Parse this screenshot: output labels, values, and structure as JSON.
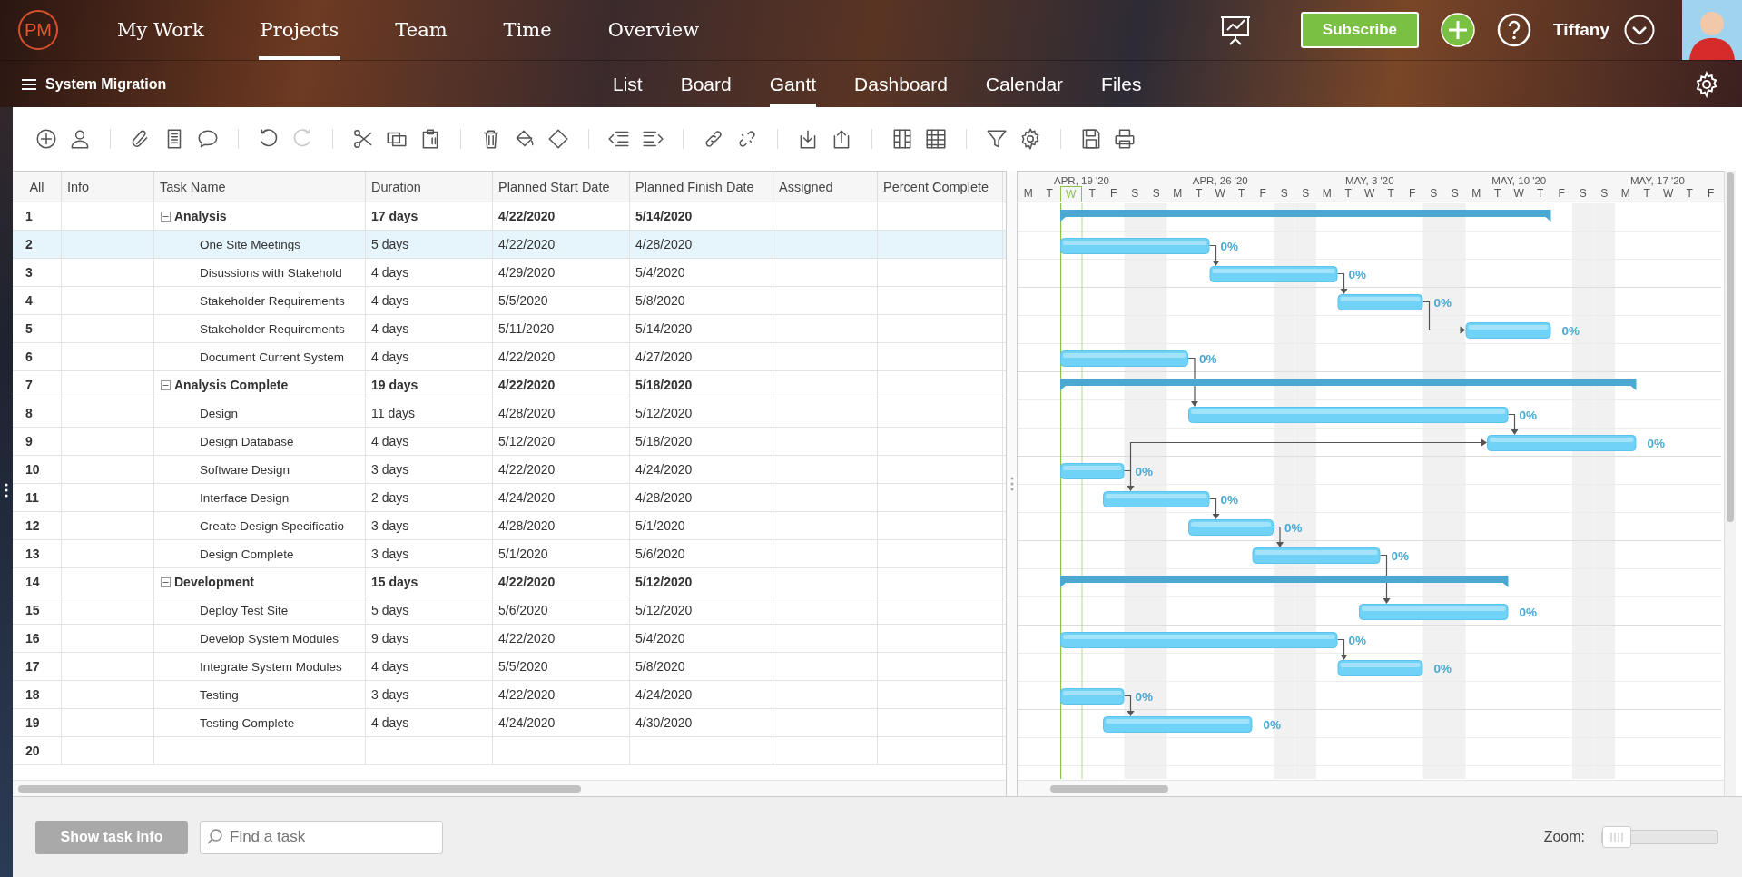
{
  "app": {
    "logo": "PM",
    "nav": [
      {
        "label": "My Work",
        "selected": false
      },
      {
        "label": "Projects",
        "selected": true
      },
      {
        "label": "Team",
        "selected": false
      },
      {
        "label": "Time",
        "selected": false
      },
      {
        "label": "Overview",
        "selected": false
      }
    ],
    "subscribe": "Subscribe",
    "user": "Tiffany"
  },
  "project": {
    "title": "System Migration",
    "views": [
      {
        "label": "List",
        "selected": false
      },
      {
        "label": "Board",
        "selected": false
      },
      {
        "label": "Gantt",
        "selected": true
      },
      {
        "label": "Dashboard",
        "selected": false
      },
      {
        "label": "Calendar",
        "selected": false
      },
      {
        "label": "Files",
        "selected": false
      }
    ]
  },
  "toolbar": {
    "undo_disabled": false,
    "redo_disabled": true
  },
  "grid": {
    "columns": [
      "All",
      "Info",
      "Task Name",
      "Duration",
      "Planned Start Date",
      "Planned Finish Date",
      "Assigned",
      "Percent Complete"
    ],
    "rows": [
      {
        "num": "1",
        "kind": "summary",
        "expanded": true,
        "selected": false,
        "name": "Analysis",
        "duration": "17 days",
        "start": "4/22/2020",
        "finish": "5/14/2020"
      },
      {
        "num": "2",
        "kind": "task",
        "selected": true,
        "name": "One Site Meetings",
        "duration": "5 days",
        "start": "4/22/2020",
        "finish": "4/28/2020",
        "bar_label": "0%"
      },
      {
        "num": "3",
        "kind": "task",
        "selected": false,
        "name": "Disussions with Stakehold",
        "duration": "4 days",
        "start": "4/29/2020",
        "finish": "5/4/2020",
        "bar_label": "0%"
      },
      {
        "num": "4",
        "kind": "task",
        "selected": false,
        "name": "Stakeholder Requirements",
        "duration": "4 days",
        "start": "5/5/2020",
        "finish": "5/8/2020",
        "bar_label": "0%"
      },
      {
        "num": "5",
        "kind": "task",
        "selected": false,
        "name": "Stakeholder Requirements",
        "duration": "4 days",
        "start": "5/11/2020",
        "finish": "5/14/2020",
        "bar_label": "0%"
      },
      {
        "num": "6",
        "kind": "task",
        "selected": false,
        "name": "Document Current System",
        "duration": "4 days",
        "start": "4/22/2020",
        "finish": "4/27/2020",
        "bar_label": "0%"
      },
      {
        "num": "7",
        "kind": "summary",
        "expanded": true,
        "selected": false,
        "name": "Analysis Complete",
        "duration": "19 days",
        "start": "4/22/2020",
        "finish": "5/18/2020"
      },
      {
        "num": "8",
        "kind": "task",
        "selected": false,
        "name": "Design",
        "duration": "11 days",
        "start": "4/28/2020",
        "finish": "5/12/2020",
        "bar_label": "0%"
      },
      {
        "num": "9",
        "kind": "task",
        "selected": false,
        "name": "Design Database",
        "duration": "4 days",
        "start": "5/12/2020",
        "finish": "5/18/2020",
        "bar_label": "0%"
      },
      {
        "num": "10",
        "kind": "task",
        "selected": false,
        "name": "Software Design",
        "duration": "3 days",
        "start": "4/22/2020",
        "finish": "4/24/2020",
        "bar_label": "0%"
      },
      {
        "num": "11",
        "kind": "task",
        "selected": false,
        "name": "Interface Design",
        "duration": "2 days",
        "start": "4/24/2020",
        "finish": "4/28/2020",
        "bar_label": "0%"
      },
      {
        "num": "12",
        "kind": "task",
        "selected": false,
        "name": "Create Design Specificatio",
        "duration": "3 days",
        "start": "4/28/2020",
        "finish": "5/1/2020",
        "bar_label": "0%"
      },
      {
        "num": "13",
        "kind": "task",
        "selected": false,
        "name": "Design Complete",
        "duration": "3 days",
        "start": "5/1/2020",
        "finish": "5/6/2020",
        "bar_label": "0%"
      },
      {
        "num": "14",
        "kind": "summary",
        "expanded": true,
        "selected": false,
        "name": "Development",
        "duration": "15 days",
        "start": "4/22/2020",
        "finish": "5/12/2020"
      },
      {
        "num": "15",
        "kind": "task",
        "selected": false,
        "name": "Deploy Test Site",
        "duration": "5 days",
        "start": "5/6/2020",
        "finish": "5/12/2020",
        "bar_label": "0%"
      },
      {
        "num": "16",
        "kind": "task",
        "selected": false,
        "name": "Develop System Modules",
        "duration": "9 days",
        "start": "4/22/2020",
        "finish": "5/4/2020",
        "bar_label": "0%"
      },
      {
        "num": "17",
        "kind": "task",
        "selected": false,
        "name": "Integrate System Modules",
        "duration": "4 days",
        "start": "5/5/2020",
        "finish": "5/8/2020",
        "bar_label": "0%"
      },
      {
        "num": "18",
        "kind": "task",
        "selected": false,
        "name": "Testing",
        "duration": "3 days",
        "start": "4/22/2020",
        "finish": "4/24/2020",
        "bar_label": "0%"
      },
      {
        "num": "19",
        "kind": "task",
        "selected": false,
        "name": "Testing Complete",
        "duration": "4 days",
        "start": "4/24/2020",
        "finish": "4/30/2020",
        "bar_label": "0%"
      },
      {
        "num": "20",
        "kind": "empty",
        "selected": false
      }
    ]
  },
  "gantt": {
    "weeks": [
      {
        "label": "APR, 19 '20",
        "days": [
          {
            "letter": "M",
            "weekend": false,
            "today": false
          },
          {
            "letter": "T",
            "weekend": false,
            "today": false
          },
          {
            "letter": "W",
            "weekend": false,
            "today": true
          },
          {
            "letter": "T",
            "weekend": false,
            "today": false
          },
          {
            "letter": "F",
            "weekend": false,
            "today": false
          },
          {
            "letter": "S",
            "weekend": true,
            "today": false
          }
        ]
      },
      {
        "label": "APR, 26 '20",
        "days": [
          {
            "letter": "S",
            "weekend": true,
            "today": false
          },
          {
            "letter": "M",
            "weekend": false,
            "today": false
          },
          {
            "letter": "T",
            "weekend": false,
            "today": false
          },
          {
            "letter": "W",
            "weekend": false,
            "today": false
          },
          {
            "letter": "T",
            "weekend": false,
            "today": false
          },
          {
            "letter": "F",
            "weekend": false,
            "today": false
          },
          {
            "letter": "S",
            "weekend": true,
            "today": false
          }
        ]
      },
      {
        "label": "MAY, 3 '20",
        "days": [
          {
            "letter": "S",
            "weekend": true,
            "today": false
          },
          {
            "letter": "M",
            "weekend": false,
            "today": false
          },
          {
            "letter": "T",
            "weekend": false,
            "today": false
          },
          {
            "letter": "W",
            "weekend": false,
            "today": false
          },
          {
            "letter": "T",
            "weekend": false,
            "today": false
          },
          {
            "letter": "F",
            "weekend": false,
            "today": false
          },
          {
            "letter": "S",
            "weekend": true,
            "today": false
          }
        ]
      },
      {
        "label": "MAY, 10 '20",
        "days": [
          {
            "letter": "S",
            "weekend": true,
            "today": false
          },
          {
            "letter": "M",
            "weekend": false,
            "today": false
          },
          {
            "letter": "T",
            "weekend": false,
            "today": false
          },
          {
            "letter": "W",
            "weekend": false,
            "today": false
          },
          {
            "letter": "T",
            "weekend": false,
            "today": false
          },
          {
            "letter": "F",
            "weekend": false,
            "today": false
          },
          {
            "letter": "S",
            "weekend": true,
            "today": false
          }
        ]
      },
      {
        "label": "MAY, 17 '20",
        "days": [
          {
            "letter": "S",
            "weekend": true,
            "today": false
          },
          {
            "letter": "M",
            "weekend": false,
            "today": false
          },
          {
            "letter": "T",
            "weekend": false,
            "today": false
          },
          {
            "letter": "W",
            "weekend": false,
            "today": false
          },
          {
            "letter": "T",
            "weekend": false,
            "today": false
          },
          {
            "letter": "F",
            "weekend": false,
            "today": false
          }
        ]
      }
    ],
    "today_line": true
  },
  "footer": {
    "show_info": "Show task info",
    "search_placeholder": "Find a task",
    "zoom_label": "Zoom:",
    "zoom": {
      "level": 0.0
    }
  }
}
